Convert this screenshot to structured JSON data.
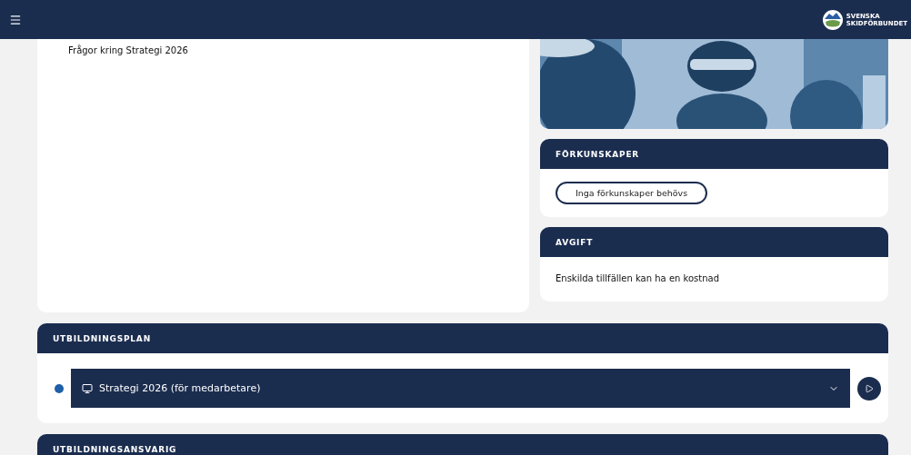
{
  "header": {
    "logo_lines": [
      "SVENSKA",
      "SKIDFÖRBUNDET"
    ]
  },
  "description": {
    "text": "Frågor kring Strategi 2026"
  },
  "prerequisites": {
    "title": "FÖRKUNSKAPER",
    "tags": [
      "Inga förkunskaper behövs"
    ]
  },
  "fee": {
    "title": "AVGIFT",
    "text": "Enskilda tillfällen kan ha en kostnad"
  },
  "plan": {
    "title": "UTBILDNINGSPLAN",
    "items": [
      {
        "label": "Strategi 2026 (för medarbetare)",
        "expanded": false
      }
    ]
  },
  "responsible": {
    "title": "UTBILDNINGSANSVARIG"
  }
}
